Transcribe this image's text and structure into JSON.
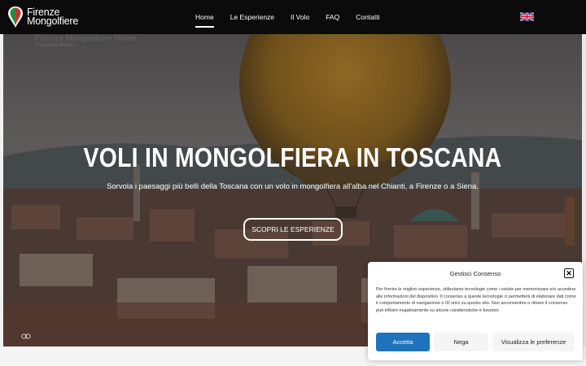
{
  "header": {
    "logo_line1": "Firenze",
    "logo_line2": "Mongolfiere",
    "nav": [
      "Home",
      "Le Esperienze",
      "Il Volo",
      "FAQ",
      "Contatti"
    ],
    "active_index": 0,
    "language_flag": "uk-flag-icon"
  },
  "hero": {
    "video_title": "Firenze Mongolfiere Home",
    "video_author": "Francesco Mauro",
    "title": "VOLI IN MONGOLFIERA IN TOSCANA",
    "subtitle": "Sorvola i paesaggi più belli della Toscana con un volo in mongolfiera all'alba nel Chianti, a Firenze o a Siena.",
    "cta_label": "SCOPRI LE ESPERIENZE",
    "corner_icon": "link-icon"
  },
  "cookie": {
    "title": "Gestisci Consenso",
    "body": "Per fornire le migliori esperienze, utilizziamo tecnologie come i cookie per memorizzare e/o accedere alle informazioni del dispositivo. Il consenso a queste tecnologie ci permetterà di elaborare dati come il comportamento di navigazione o ID unici su questo sito. Non acconsentire o ritirare il consenso può influire negativamente su alcune caratteristiche e funzioni.",
    "accept_label": "Accetta",
    "deny_label": "Nega",
    "prefs_label": "Visualizza le preferenze"
  },
  "colors": {
    "header_bg": "#0b0b0b",
    "accept_blue": "#1e73be"
  }
}
